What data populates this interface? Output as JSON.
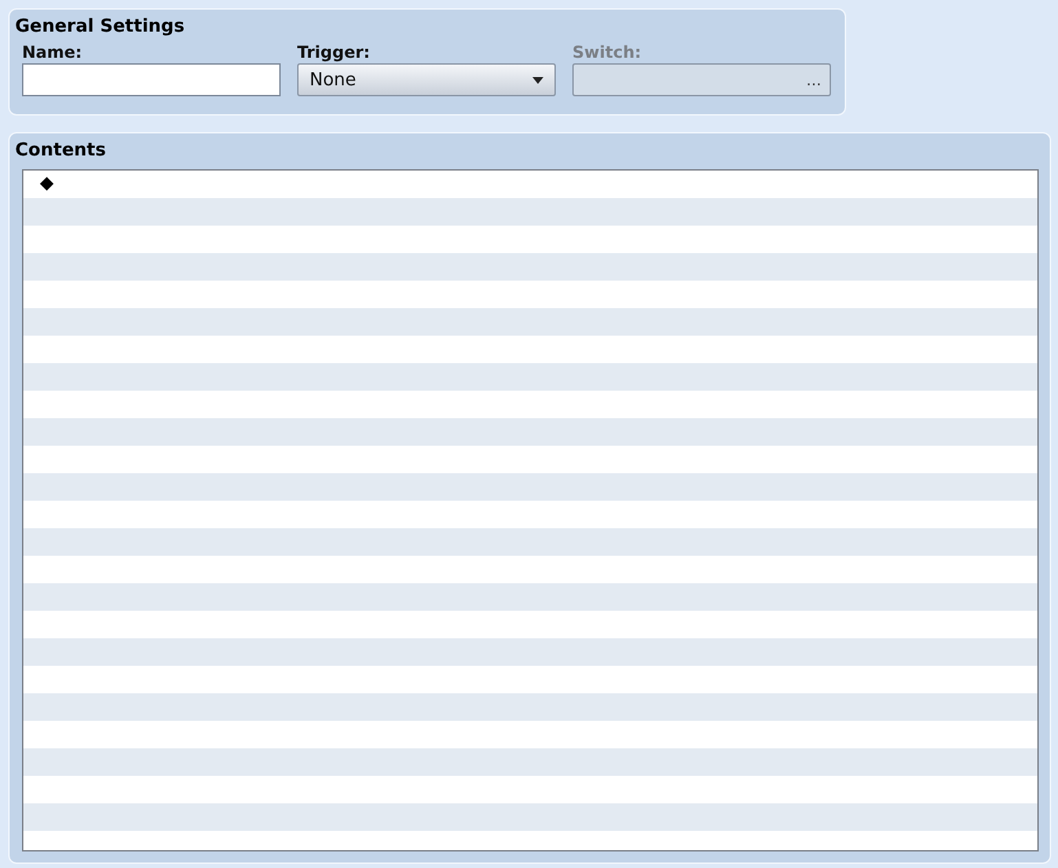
{
  "general_settings": {
    "title": "General Settings",
    "name": {
      "label": "Name:"
    },
    "trigger": {
      "label": "Trigger:",
      "value": "None"
    },
    "switch": {
      "label": "Switch:",
      "disabled": true,
      "button": "…"
    }
  },
  "contents": {
    "title": "Contents",
    "items": [
      {
        "text": "◆"
      }
    ]
  }
}
